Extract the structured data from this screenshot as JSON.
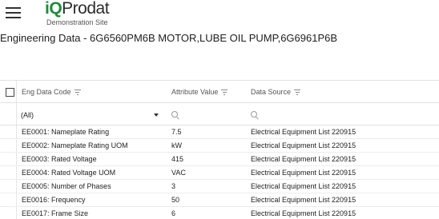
{
  "header": {
    "logo_prefix": "iQ",
    "logo_name": "Prodat",
    "logo_subtitle": "Demonstration Site"
  },
  "page": {
    "title": "Engineering Data - 6G6560PM6B MOTOR,LUBE OIL PUMP,6G6961P6B"
  },
  "grid": {
    "columns": [
      {
        "label": "Eng Data Code"
      },
      {
        "label": "Attribute Value"
      },
      {
        "label": "Data Source"
      }
    ],
    "filters": {
      "code_select": "(All)",
      "value_search": "",
      "source_search": ""
    },
    "rows": [
      {
        "code": "EE0001: Nameplate Rating",
        "value": "7.5",
        "source": "Electrical Equipment List 220915"
      },
      {
        "code": "EE0002: Nameplate Rating UOM",
        "value": "kW",
        "source": "Electrical Equipment List 220915"
      },
      {
        "code": "EE0003: Rated Voltage",
        "value": "415",
        "source": "Electrical Equipment List 220915"
      },
      {
        "code": "EE0004: Rated Voltage UOM",
        "value": "VAC",
        "source": "Electrical Equipment List 220915"
      },
      {
        "code": "EE0005: Number of Phases",
        "value": "3",
        "source": "Electrical Equipment List 220915"
      },
      {
        "code": "EE0016: Frequency",
        "value": "50",
        "source": "Electrical Equipment List 220915"
      },
      {
        "code": "EE0017: Frame Size",
        "value": "6",
        "source": "Electrical Equipment List 220915"
      }
    ]
  }
}
